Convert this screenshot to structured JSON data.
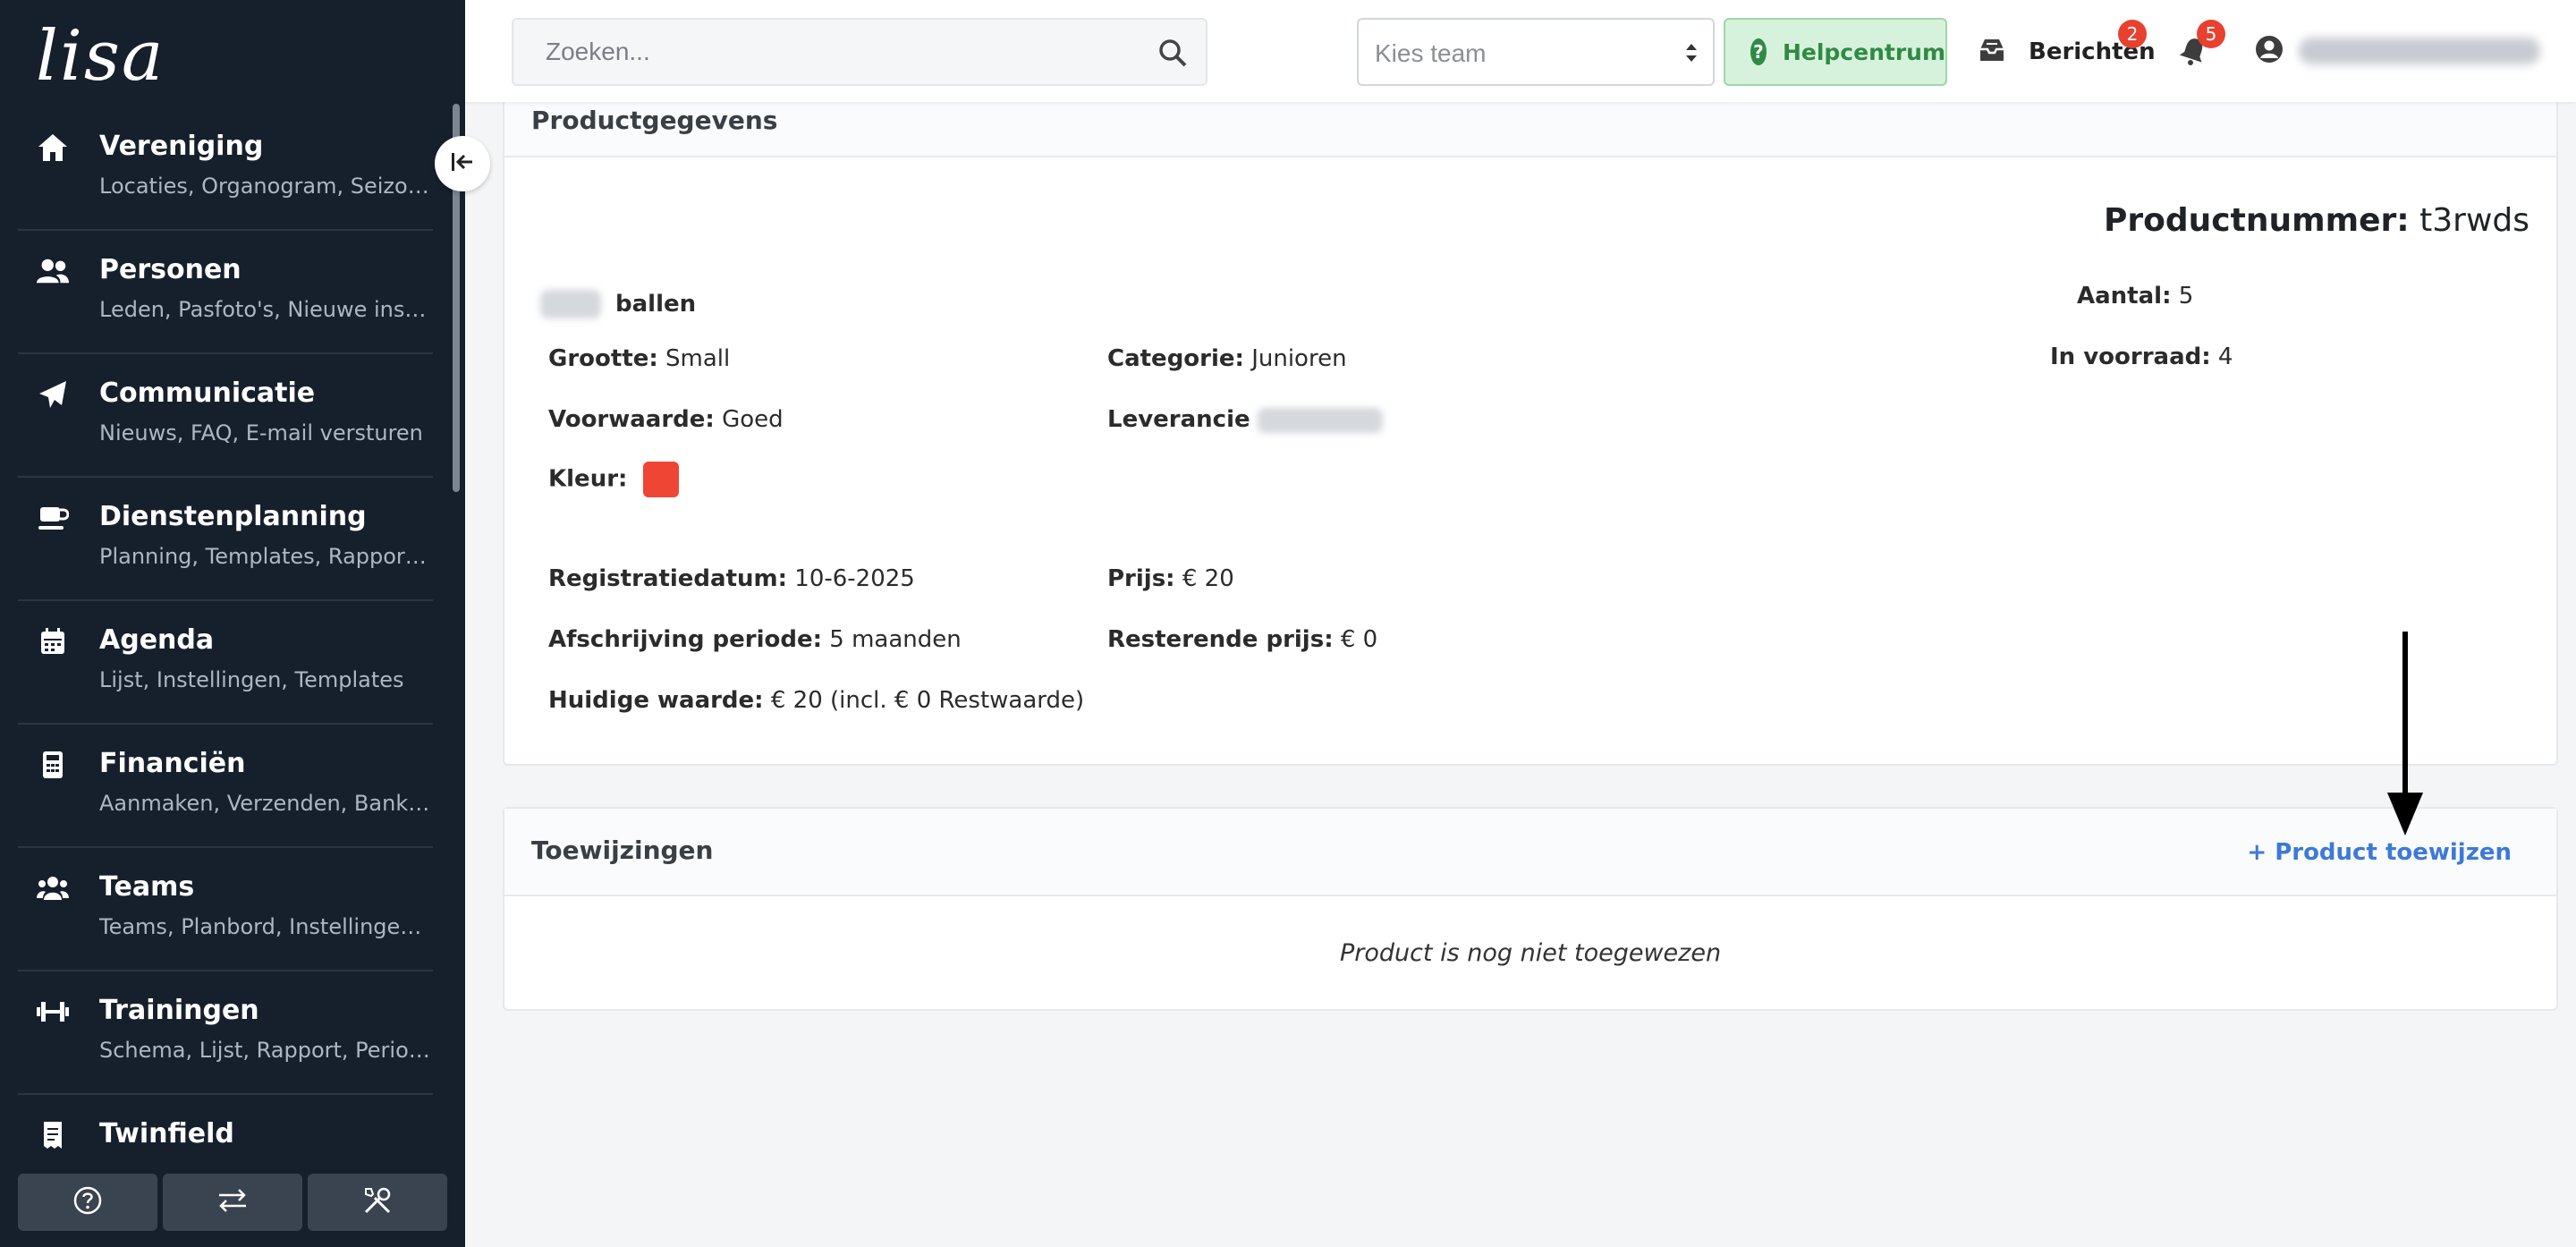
{
  "app": {
    "logo": "lisa"
  },
  "sidebar": {
    "items": [
      {
        "title": "Vereniging",
        "sub": "Locaties, Organogram, Seizoenen",
        "icon": "home-icon"
      },
      {
        "title": "Personen",
        "sub": "Leden, Pasfoto's, Nieuwe inschrijvingen",
        "icon": "users-icon"
      },
      {
        "title": "Communicatie",
        "sub": "Nieuws, FAQ, E-mail versturen",
        "icon": "paper-plane-icon"
      },
      {
        "title": "Dienstenplanning",
        "sub": "Planning, Templates, Rapport, Instellingen",
        "icon": "coffee-icon"
      },
      {
        "title": "Agenda",
        "sub": "Lijst, Instellingen, Templates",
        "icon": "calendar-icon"
      },
      {
        "title": "Financiën",
        "sub": "Aanmaken, Verzenden, Bankbestanden",
        "icon": "calculator-icon"
      },
      {
        "title": "Teams",
        "sub": "Teams, Planbord, Instellingen, Spelers",
        "icon": "team-icon"
      },
      {
        "title": "Trainingen",
        "sub": "Schema, Lijst, Rapport, Periodes",
        "icon": "dumbbell-icon"
      },
      {
        "title": "Twinfield",
        "sub": "",
        "icon": "receipt-icon"
      }
    ],
    "footer_icons": [
      "help-circle-icon",
      "swap-icon",
      "tools-icon"
    ]
  },
  "topbar": {
    "search_placeholder": "Zoeken...",
    "team_placeholder": "Kies team",
    "help_label": "Helpcentrum",
    "messages_label": "Berichten",
    "messages_count": "2",
    "notifications_count": "5"
  },
  "product": {
    "section_title": "Productgegevens",
    "number_label": "Productnummer:",
    "number_value": "t3rwds",
    "name": "ballen",
    "fields": {
      "grootte_k": "Grootte:",
      "grootte_v": "Small",
      "categorie_k": "Categorie:",
      "categorie_v": "Junioren",
      "voorwaarde_k": "Voorwaarde:",
      "voorwaarde_v": "Goed",
      "leverancier_k": "Leverancie",
      "kleur_k": "Kleur:",
      "aantal_k": "Aantal:",
      "aantal_v": "5",
      "voorraad_k": "In voorraad:",
      "voorraad_v": "4",
      "registratie_k": "Registratiedatum:",
      "registratie_v": "10-6-2025",
      "prijs_k": "Prijs:",
      "prijs_v": "€ 20",
      "afschrijving_k": "Afschrijving periode:",
      "afschrijving_v": "5 maanden",
      "resterend_k": "Resterende prijs:",
      "resterend_v": "€ 0",
      "waarde_k": "Huidige waarde:",
      "waarde_v": "€ 20 (incl. € 0 Restwaarde)"
    },
    "color_hex": "#ee4535"
  },
  "assignments": {
    "section_title": "Toewijzingen",
    "assign_link": "+ Product toewijzen",
    "empty_message": "Product is nog niet toegewezen"
  }
}
